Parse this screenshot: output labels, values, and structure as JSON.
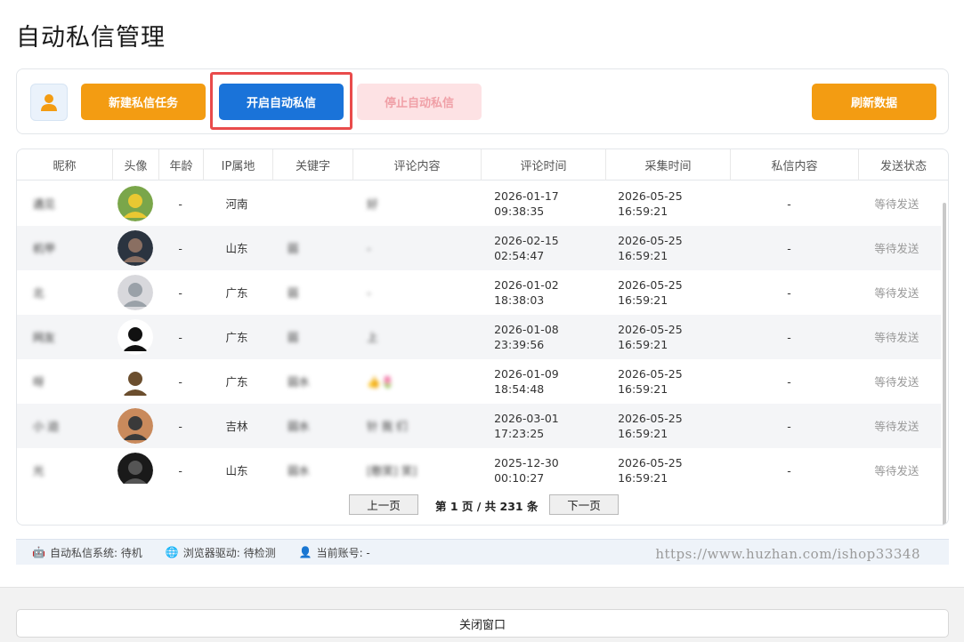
{
  "page": {
    "title": "自动私信管理"
  },
  "toolbar": {
    "new_task": "新建私信任务",
    "start_auto": "开启自动私信",
    "stop_auto": "停止自动私信",
    "refresh": "刷新数据"
  },
  "table": {
    "headers": [
      "昵称",
      "头像",
      "年龄",
      "IP属地",
      "关键字",
      "评论内容",
      "评论时间",
      "采集时间",
      "私信内容",
      "发送状态"
    ],
    "rows": [
      {
        "nickname": "遇见",
        "age": "-",
        "ip": "河南",
        "keyword": "",
        "comment": "好",
        "comment_date": "2026-01-17",
        "comment_time": "09:38:35",
        "collect_date": "2026-05-25",
        "collect_time": "16:59:21",
        "message": "-",
        "status": "等待发送"
      },
      {
        "nickname": "机甲",
        "age": "-",
        "ip": "山东",
        "keyword": "弱",
        "comment": "-",
        "comment_date": "2026-02-15",
        "comment_time": "02:54:47",
        "collect_date": "2026-05-25",
        "collect_time": "16:59:21",
        "message": "-",
        "status": "等待发送"
      },
      {
        "nickname": "北",
        "age": "-",
        "ip": "广东",
        "keyword": "弱",
        "comment": "-",
        "comment_date": "2026-01-02",
        "comment_time": "18:38:03",
        "collect_date": "2026-05-25",
        "collect_time": "16:59:21",
        "message": "-",
        "status": "等待发送"
      },
      {
        "nickname": "网友",
        "age": "-",
        "ip": "广东",
        "keyword": "弱",
        "comment": "上",
        "comment_date": "2026-01-08",
        "comment_time": "23:39:56",
        "collect_date": "2026-05-25",
        "collect_time": "16:59:21",
        "message": "-",
        "status": "等待发送"
      },
      {
        "nickname": "呀",
        "age": "-",
        "ip": "广东",
        "keyword": "弱水",
        "comment": "👍🌷",
        "comment_date": "2026-01-09",
        "comment_time": "18:54:48",
        "collect_date": "2026-05-25",
        "collect_time": "16:59:21",
        "message": "-",
        "status": "等待发送"
      },
      {
        "nickname": "小 迫",
        "age": "-",
        "ip": "吉林",
        "keyword": "弱水",
        "comment": "针 我 们",
        "comment_date": "2026-03-01",
        "comment_time": "17:23:25",
        "collect_date": "2026-05-25",
        "collect_time": "16:59:21",
        "message": "-",
        "status": "等待发送"
      },
      {
        "nickname": "光",
        "age": "-",
        "ip": "山东",
        "keyword": "弱水",
        "comment": "[憨笑] 笑]",
        "comment_date": "2025-12-30",
        "comment_time": "00:10:27",
        "collect_date": "2026-05-25",
        "collect_time": "16:59:21",
        "message": "-",
        "status": "等待发送"
      }
    ]
  },
  "pager": {
    "prev": "上一页",
    "info": "第 1 页 / 共 231 条",
    "next": "下一页"
  },
  "statusbar": {
    "system": "自动私信系统: 待机",
    "driver": "浏览器驱动: 待检测",
    "account": "当前账号: -",
    "watermark": "https://www.huzhan.com/ishop33348"
  },
  "footer": {
    "close": "关闭窗口"
  },
  "colors": {
    "orange": "#f39c12",
    "blue": "#1a73d9",
    "stop_bg": "#fde2e4",
    "highlight": "#e94b4b"
  }
}
